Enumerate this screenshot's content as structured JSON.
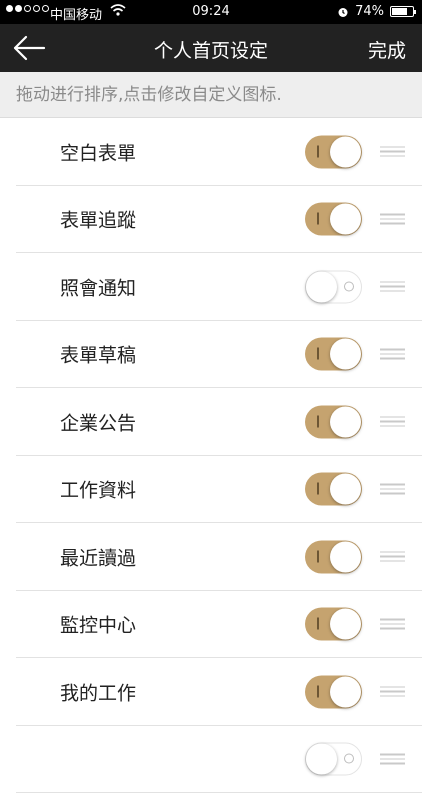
{
  "status_bar": {
    "carrier": "中国移动",
    "time": "09:24",
    "battery": "74%",
    "battery_level": 0.74
  },
  "header": {
    "title": "个人首页设定",
    "done_label": "完成"
  },
  "hint_text": "拖动进行排序,点击修改自定义图标.",
  "items": [
    {
      "label": "空白表單",
      "enabled": true
    },
    {
      "label": "表單追蹤",
      "enabled": true
    },
    {
      "label": "照會通知",
      "enabled": false
    },
    {
      "label": "表單草稿",
      "enabled": true
    },
    {
      "label": "企業公告",
      "enabled": true
    },
    {
      "label": "工作資料",
      "enabled": true
    },
    {
      "label": "最近讀過",
      "enabled": true
    },
    {
      "label": "監控中心",
      "enabled": true
    },
    {
      "label": "我的工作",
      "enabled": true
    },
    {
      "label": "",
      "enabled": false
    }
  ],
  "colors": {
    "accent": "#c5a36f",
    "nav_bg": "#222222"
  }
}
